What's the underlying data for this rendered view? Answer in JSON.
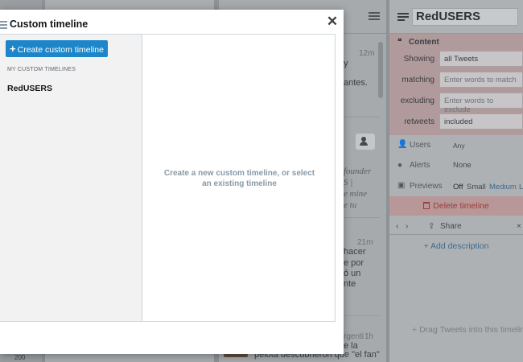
{
  "modal": {
    "title": "Custom timeline",
    "create_button_label": "Create custom timeline",
    "my_timelines_heading": "MY CUSTOM TIMELINES",
    "timelines": [
      "RedUSERS"
    ],
    "empty_message": "Create a new custom timeline, or select an existing timeline",
    "icons": {
      "title": "timeline-icon",
      "close": "close-icon",
      "create": "plus-icon"
    }
  },
  "background": {
    "tweet_fragments": {
      "time1": "12m",
      "text1": "y",
      "text2": "antes.",
      "quote1": "founder",
      "quote2": "S |",
      "quote3": "e mine",
      "quote4": "e tu",
      "time2": "21m",
      "text3": "hacer",
      "text4": "e por",
      "text5": "ó un",
      "text6": "nte",
      "user_frag": "rgenti",
      "time3": "1h",
      "text7": "e la",
      "text8": "pelota descubrieron que \"el fan\"",
      "left_frag": "200"
    }
  },
  "column": {
    "name": "RedUSERS",
    "content_heading": "Content",
    "rows": [
      {
        "label": "Showing",
        "value": "all Tweets",
        "placeholder": ""
      },
      {
        "label": "matching",
        "value": "",
        "placeholder": "Enter words to match"
      },
      {
        "label": "excluding",
        "value": "",
        "placeholder": "Enter words to exclude"
      },
      {
        "label": "retweets",
        "value": "included",
        "placeholder": ""
      }
    ],
    "users_label": "Users",
    "users_value": "Any",
    "alerts_label": "Alerts",
    "alerts_value": "None",
    "previews_label": "Previews",
    "previews_options": [
      "Off",
      "Small",
      "Medium",
      "L"
    ],
    "delete_label": "Delete timeline",
    "share_label": "Share",
    "close_label": "×",
    "add_description_label": "Add description",
    "drag_hint": "Drag Tweets into this timeline"
  }
}
